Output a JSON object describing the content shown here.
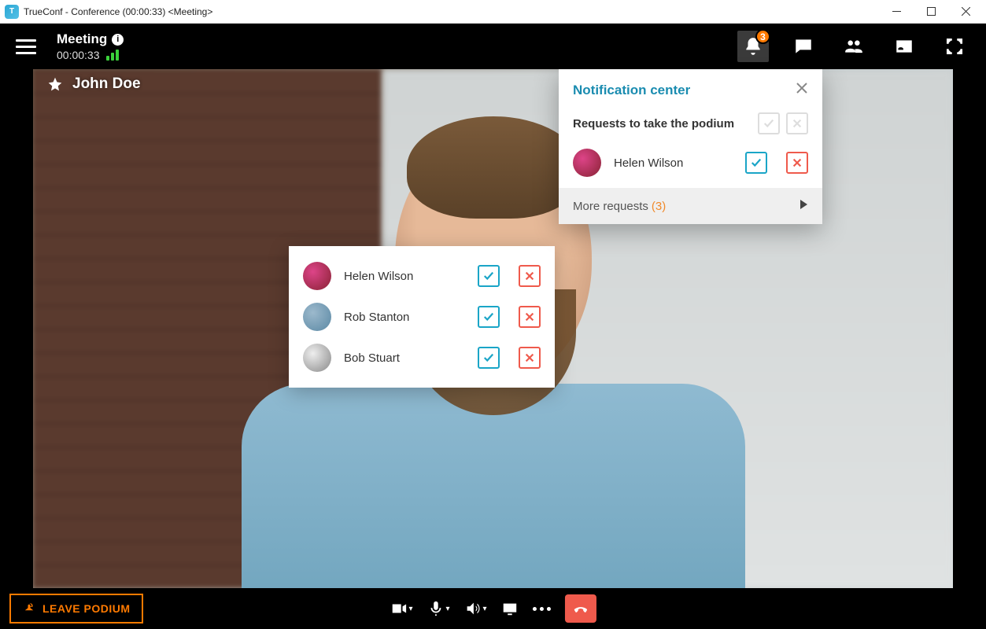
{
  "window": {
    "title": "TrueConf - Conference (00:00:33) <Meeting>"
  },
  "header": {
    "meeting_title": "Meeting",
    "timer": "00:00:33",
    "notification_badge": "3"
  },
  "participant": {
    "name": "John Doe"
  },
  "requests_popup": {
    "items": [
      {
        "name": "Helen Wilson"
      },
      {
        "name": "Rob Stanton"
      },
      {
        "name": "Bob Stuart"
      }
    ]
  },
  "notification_center": {
    "title": "Notification center",
    "section_title": "Requests to take the podium",
    "request": {
      "name": "Helen Wilson"
    },
    "more_label": "More requests",
    "more_count": "(3)"
  },
  "bottom": {
    "leave_label": "LEAVE PODIUM"
  }
}
